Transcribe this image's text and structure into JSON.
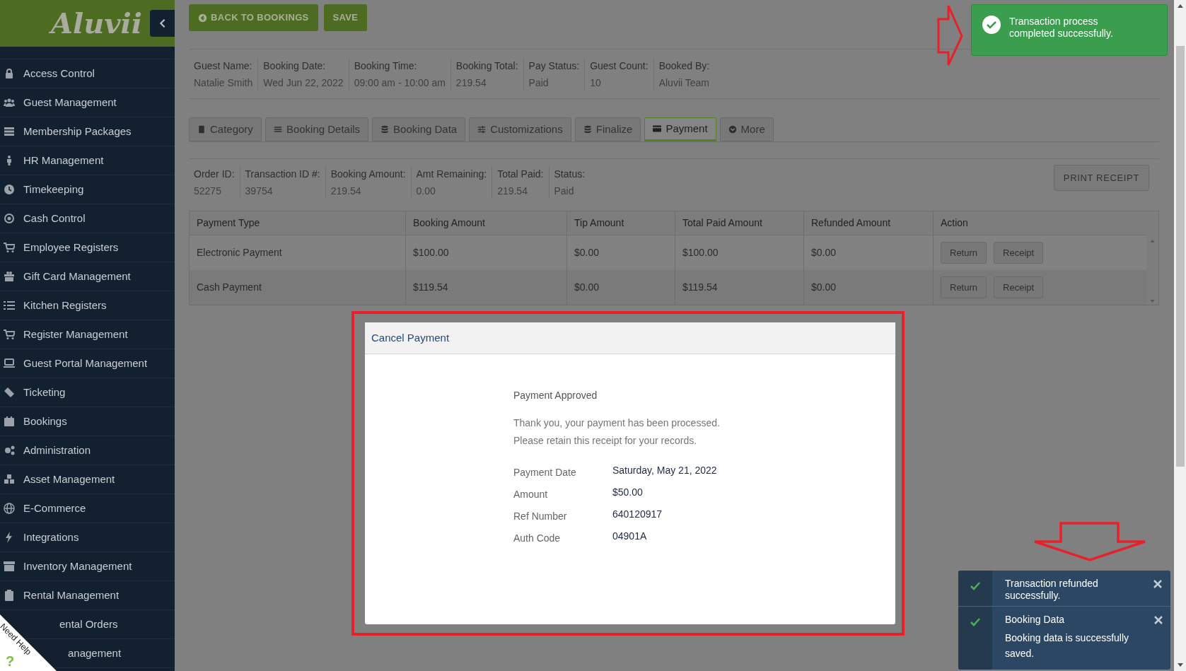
{
  "sidebar": {
    "logo": "Aluvii",
    "items": [
      {
        "label": "Access Control"
      },
      {
        "label": "Guest Management"
      },
      {
        "label": "Membership Packages"
      },
      {
        "label": "HR Management"
      },
      {
        "label": "Timekeeping"
      },
      {
        "label": "Cash Control"
      },
      {
        "label": "Employee Registers"
      },
      {
        "label": "Gift Card Management"
      },
      {
        "label": "Kitchen Registers"
      },
      {
        "label": "Register Management"
      },
      {
        "label": "Guest Portal Management"
      },
      {
        "label": "Ticketing"
      },
      {
        "label": "Bookings"
      },
      {
        "label": "Administration"
      },
      {
        "label": "Asset Management"
      },
      {
        "label": "E-Commerce"
      },
      {
        "label": "Integrations"
      },
      {
        "label": "Inventory Management"
      },
      {
        "label": "Rental Management"
      },
      {
        "label": "ental Orders"
      },
      {
        "label": "anagement"
      }
    ]
  },
  "toolbar": {
    "buttons": [
      {
        "label": "BACK TO BOOKINGS",
        "kind": "back"
      },
      {
        "label": "SAVE",
        "kind": "plain"
      }
    ]
  },
  "booking_summary": [
    {
      "label": "Guest Name:",
      "value": "Natalie Smith"
    },
    {
      "label": "Booking Date:",
      "value": "Wed Jun 22, 2022"
    },
    {
      "label": "Booking Time:",
      "value": "09:00 am - 10:00 am"
    },
    {
      "label": "Booking Total:",
      "value": "219.54"
    },
    {
      "label": "Pay Status:",
      "value": "Paid"
    },
    {
      "label": "Guest Count:",
      "value": "10"
    },
    {
      "label": "Booked By:",
      "value": "Aluvii Team"
    }
  ],
  "tabs": [
    {
      "label": "Category",
      "selected": false
    },
    {
      "label": "Booking Details",
      "selected": false
    },
    {
      "label": "Booking Data",
      "selected": false
    },
    {
      "label": "Customizations",
      "selected": false
    },
    {
      "label": "Finalize",
      "selected": false
    },
    {
      "label": "Payment",
      "selected": true
    },
    {
      "label": "More",
      "selected": false
    }
  ],
  "payment_summary": [
    {
      "label": "Order ID:",
      "value": "52275"
    },
    {
      "label": "Transaction ID #:",
      "value": "39754"
    },
    {
      "label": "Booking Amount:",
      "value": "219.54"
    },
    {
      "label": "Amt Remaining:",
      "value": "0.00"
    },
    {
      "label": "Total Paid:",
      "value": "219.54"
    },
    {
      "label": "Status:",
      "value": "Paid"
    }
  ],
  "print_button": "PRINT RECEIPT",
  "table": {
    "columns": [
      "Payment Type",
      "Booking Amount",
      "Tip Amount",
      "Total Paid Amount",
      "Refunded Amount",
      "Action"
    ],
    "rows": [
      {
        "cells": [
          "Electronic Payment",
          "$100.00",
          "$0.00",
          "$100.00",
          "$0.00"
        ],
        "actions": [
          "Return",
          "Receipt"
        ]
      },
      {
        "cells": [
          "Cash Payment",
          "$119.54",
          "$0.00",
          "$119.54",
          "$0.00"
        ],
        "actions": [
          "Return",
          "Receipt"
        ]
      }
    ]
  },
  "modal": {
    "title": "Cancel Payment",
    "heading": "Payment Approved",
    "message": [
      "Thank you, your payment has been processed.",
      "Please retain this receipt for your records."
    ],
    "details": [
      {
        "label": "Payment Date",
        "value": "Saturday, May 21, 2022"
      },
      {
        "label": "Amount",
        "value": "$50.00"
      },
      {
        "label": "Ref Number",
        "value": "640120917"
      },
      {
        "label": "Auth Code",
        "value": "04901A"
      }
    ]
  },
  "toast": {
    "text": "Transaction process completed successfully."
  },
  "notifications": [
    {
      "title": "Transaction refunded successfully."
    },
    {
      "title": "Booking Data",
      "text": "Booking data is successfully saved."
    }
  ],
  "help_badge": {
    "label": "Need Help",
    "mark": "?"
  }
}
